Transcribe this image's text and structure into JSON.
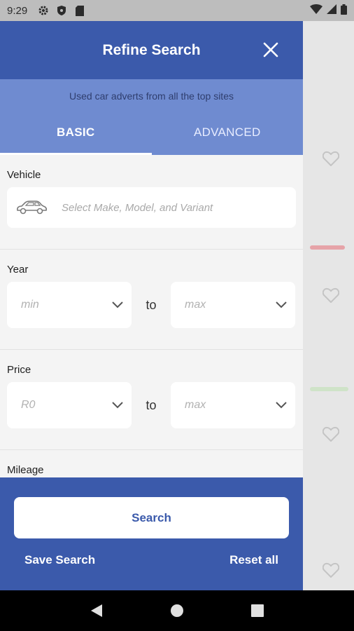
{
  "status_bar": {
    "time": "9:29",
    "left_icons": [
      "gear-icon",
      "shield-icon",
      "sd-card-icon"
    ],
    "right_icons": [
      "wifi-icon",
      "signal-icon",
      "battery-icon"
    ]
  },
  "drawer": {
    "title": "Refine Search",
    "tagline": "Used car adverts from all the top sites",
    "tabs": [
      {
        "label": "BASIC",
        "active": true
      },
      {
        "label": "ADVANCED",
        "active": false
      }
    ],
    "vehicle": {
      "label": "Vehicle",
      "placeholder": "Select Make, Model, and Variant"
    },
    "year": {
      "label": "Year",
      "min": "min",
      "separator": "to",
      "max": "max"
    },
    "price": {
      "label": "Price",
      "min": "R0",
      "separator": "to",
      "max": "max"
    },
    "mileage": {
      "label": "Mileage"
    },
    "footer": {
      "search_label": "Search",
      "save_label": "Save Search",
      "reset_label": "Reset all"
    }
  },
  "colors": {
    "primary": "#3b5aab",
    "secondary": "#6f8bd0",
    "surface": "#f4f4f4"
  }
}
